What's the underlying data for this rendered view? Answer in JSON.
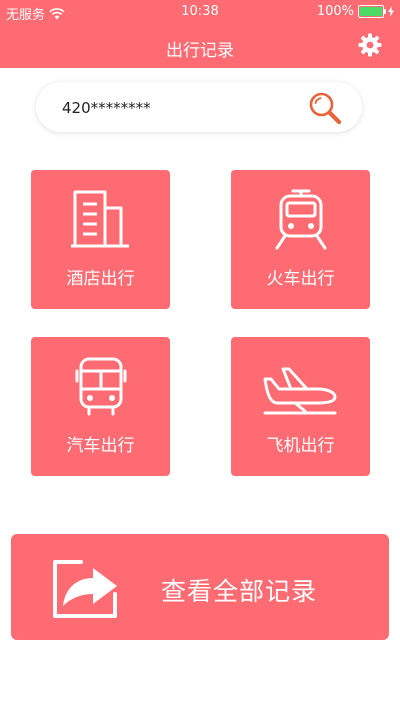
{
  "status": {
    "carrier": "无服务",
    "time": "10:38",
    "battery": "100%"
  },
  "header": {
    "title": "出行记录"
  },
  "search": {
    "value": "420********"
  },
  "tiles": [
    {
      "label": "酒店出行",
      "icon": "hotel-building-icon"
    },
    {
      "label": "火车出行",
      "icon": "train-icon"
    },
    {
      "label": "汽车出行",
      "icon": "bus-icon"
    },
    {
      "label": "飞机出行",
      "icon": "airplane-icon"
    }
  ],
  "all_records": {
    "label": "查看全部记录",
    "icon": "share-export-icon"
  },
  "colors": {
    "accent": "#fe6b72",
    "battery": "#4cd964",
    "search_icon": "#e8623a"
  }
}
